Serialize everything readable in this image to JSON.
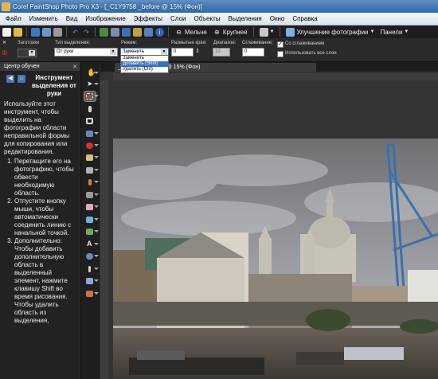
{
  "window": {
    "title": "Corel PaintShop Photo Pro X3 - [_C1Y9758 _before @ 15% (Фон)]"
  },
  "menu": [
    "Файл",
    "Изменить",
    "Вид",
    "Изображение",
    "Эффекты",
    "Слои",
    "Объекты",
    "Выделения",
    "Окно",
    "Справка"
  ],
  "toolbar": {
    "less_sharp": "Мельче",
    "more_sharp": "Крупнее",
    "enhance": "Улучшение фотографии",
    "panels": "Панели"
  },
  "options": {
    "presets_label": "Заготовки",
    "selection_type_label": "Тип выделения:",
    "selection_type_value": "От руки",
    "mode_label": "Режим:",
    "mode_value": "Заменить",
    "mode_options": [
      "Заменить",
      "Добавить (Shift)",
      "Удалить (Ctrl)"
    ],
    "mode_selected_index": 1,
    "feather_label": "Размытые края:",
    "feather_value": "0",
    "range_label": "Диапазон:",
    "range_value": "10",
    "smoothing_label": "Сглаживание:",
    "smoothing_value": "0",
    "antialias_label": "Со сглаживанием",
    "antialias_checked": true,
    "all_layers_label": "Использовать все слои",
    "all_layers_checked": false
  },
  "learning_center": {
    "header": "Центр обучен",
    "title": "Инструмент выделения от руки",
    "intro": "Используйте этот инструмент, чтобы выделить на фотографии области неправильной формы для копирования или редактирования.",
    "steps": [
      "Перетащите его на фотографию, чтобы обвести необходимую область.",
      "Отпустите кнопку мыши, чтобы автоматически соединить линию с начальной точкой.",
      "Дополнительно: Чтобы добавить дополнительную область в выделенный элемент, нажмите клавишу Shift во время рисования. Чтобы удалить область из выделения,"
    ]
  },
  "document": {
    "tab_title": "_C1Y9758 _before @ 15% (Фон)"
  },
  "colors": {
    "titlebar": "#3a73b5",
    "selection_highlight": "#3373c4",
    "workspace": "#333333"
  }
}
